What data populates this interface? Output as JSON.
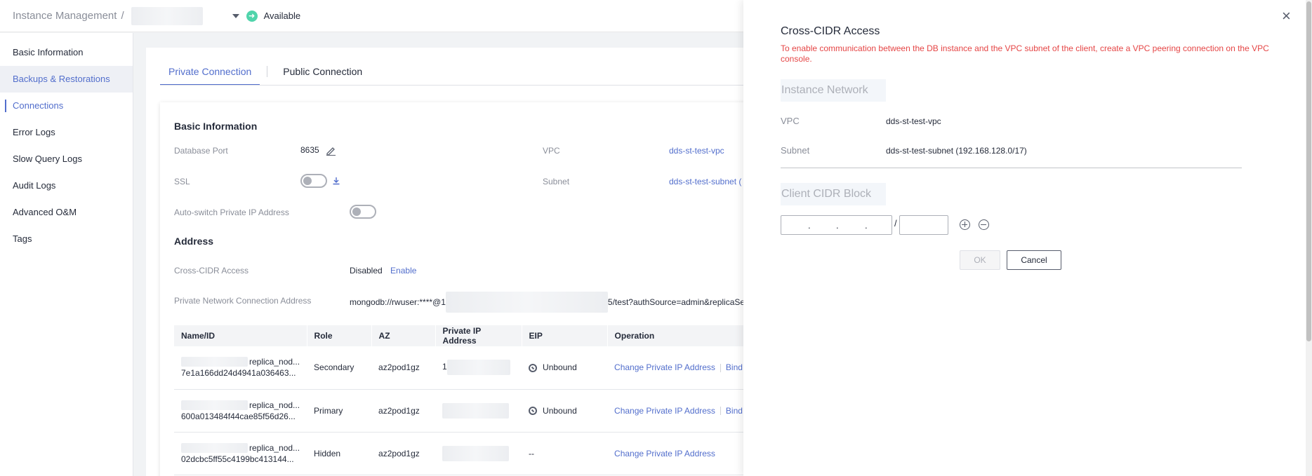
{
  "header": {
    "breadcrumb": "Instance Management",
    "separator": "/",
    "status": "Available"
  },
  "sidebar": {
    "items": [
      {
        "label": "Basic Information"
      },
      {
        "label": "Backups & Restorations"
      },
      {
        "label": "Connections"
      },
      {
        "label": "Error Logs"
      },
      {
        "label": "Slow Query Logs"
      },
      {
        "label": "Audit Logs"
      },
      {
        "label": "Advanced O&M"
      },
      {
        "label": "Tags"
      }
    ],
    "active": "Connections"
  },
  "tabs": [
    {
      "label": "Private Connection",
      "active": true
    },
    {
      "label": "Public Connection",
      "active": false
    }
  ],
  "basic_info": {
    "title": "Basic Information",
    "db_port_label": "Database Port",
    "db_port_value": "8635",
    "ssl_label": "SSL",
    "ssl_enabled": false,
    "auto_switch_label": "Auto-switch Private IP Address",
    "auto_switch_enabled": false,
    "vpc_label": "VPC",
    "vpc_value": "dds-st-test-vpc",
    "subnet_label": "Subnet",
    "subnet_value": "dds-st-test-subnet ("
  },
  "address": {
    "title": "Address",
    "cross_cidr_label": "Cross-CIDR Access",
    "cross_cidr_value": "Disabled",
    "cross_cidr_action": "Enable",
    "private_addr_label": "Private Network Connection Address",
    "private_addr_prefix": "mongodb://rwuser:****@1",
    "private_addr_suffix": "5/test?authSource=admin&replicaSe"
  },
  "table": {
    "columns": [
      "Name/ID",
      "Role",
      "AZ",
      "Private IP Address",
      "EIP",
      "Operation"
    ],
    "rows": [
      {
        "name_suffix": "replica_nod...",
        "id": "7e1a166dd24d4941a036463...",
        "role": "Secondary",
        "az": "az2pod1gz",
        "ip_prefix": "1",
        "eip": "Unbound",
        "op1": "Change Private IP Address",
        "op2": "Bind E"
      },
      {
        "name_suffix": "replica_nod...",
        "id": "600a013484f44cae85f56d26...",
        "role": "Primary",
        "az": "az2pod1gz",
        "ip_prefix": "",
        "eip": "Unbound",
        "op1": "Change Private IP Address",
        "op2": "Bind E"
      },
      {
        "name_suffix": "replica_nod...",
        "id": "02dcbc5ff55c4199bc413144...",
        "role": "Hidden",
        "az": "az2pod1gz",
        "ip_prefix": "",
        "eip": "--",
        "op1": "Change Private IP Address",
        "op2": ""
      }
    ]
  },
  "drawer": {
    "title": "Cross-CIDR Access",
    "description": "To enable communication between the DB instance and the VPC subnet of the client, create a VPC peering connection on the VPC console.",
    "instance_network_title": "Instance Network",
    "vpc_label": "VPC",
    "vpc_value": "dds-st-test-vpc",
    "subnet_label": "Subnet",
    "subnet_value": "dds-st-test-subnet (192.168.128.0/17)",
    "client_cidr_title": "Client CIDR Block",
    "ip_dots": ".",
    "slash": "/",
    "ok_label": "OK",
    "cancel_label": "Cancel"
  },
  "colors": {
    "accent": "#526ecc",
    "status_green": "#50d4ab",
    "error_red": "#e54545"
  },
  "icons": [
    "edit-icon",
    "download-icon",
    "status-available-icon",
    "close-icon",
    "add-circle-icon",
    "remove-circle-icon",
    "unbound-eip-icon",
    "chevron-down-icon"
  ]
}
